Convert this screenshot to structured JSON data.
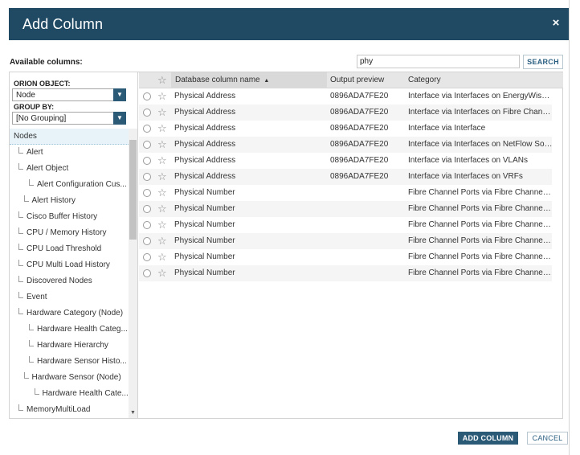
{
  "dialog": {
    "title": "Add Column",
    "close_glyph": "×"
  },
  "toolbar": {
    "available_label": "Available columns:",
    "search_value": "phy",
    "search_button": "SEARCH"
  },
  "left_panel": {
    "orion_object_label": "ORION OBJECT:",
    "orion_object_value": "Node",
    "group_by_label": "GROUP BY:",
    "group_by_value": "[No Grouping]",
    "tree": [
      {
        "label": "Nodes",
        "level": 0,
        "selected": true
      },
      {
        "label": "Alert",
        "level": 1
      },
      {
        "label": "Alert Object",
        "level": 1
      },
      {
        "label": "Alert Configuration Cus...",
        "level": 2
      },
      {
        "label": "Alert History",
        "level": 1.5
      },
      {
        "label": "Cisco Buffer History",
        "level": 1
      },
      {
        "label": "CPU / Memory History",
        "level": 1
      },
      {
        "label": "CPU Load Threshold",
        "level": 1
      },
      {
        "label": "CPU Multi Load History",
        "level": 1
      },
      {
        "label": "Discovered Nodes",
        "level": 1
      },
      {
        "label": "Event",
        "level": 1
      },
      {
        "label": "Hardware Category (Node)",
        "level": 1
      },
      {
        "label": "Hardware Health Categ...",
        "level": 2
      },
      {
        "label": "Hardware Hierarchy",
        "level": 2
      },
      {
        "label": "Hardware Sensor Histo...",
        "level": 2
      },
      {
        "label": "Hardware Sensor (Node)",
        "level": 1.5
      },
      {
        "label": "Hardware Health Cate...",
        "level": 2.5
      },
      {
        "label": "MemoryMultiLoad",
        "level": 1
      }
    ]
  },
  "grid": {
    "columns": [
      "Database column name",
      "Output preview",
      "Category"
    ],
    "sort_indicator": "▲",
    "rows": [
      {
        "name": "Physical Address",
        "preview": "0896ADA7FE20",
        "category": "Interface via Interfaces on EnergyWise ..."
      },
      {
        "name": "Physical Address",
        "preview": "0896ADA7FE20",
        "category": "Interface via Interfaces on Fibre Chann..."
      },
      {
        "name": "Physical Address",
        "preview": "0896ADA7FE20",
        "category": "Interface via Interface"
      },
      {
        "name": "Physical Address",
        "preview": "0896ADA7FE20",
        "category": "Interface via Interfaces on NetFlow Sou..."
      },
      {
        "name": "Physical Address",
        "preview": "0896ADA7FE20",
        "category": "Interface via Interfaces on VLANs"
      },
      {
        "name": "Physical Address",
        "preview": "0896ADA7FE20",
        "category": "Interface via Interfaces on VRFs"
      },
      {
        "name": "Physical Number",
        "preview": "",
        "category": "Fibre Channel Ports via Fibre Channel P..."
      },
      {
        "name": "Physical Number",
        "preview": "",
        "category": "Fibre Channel Ports via Fibre Channel P..."
      },
      {
        "name": "Physical Number",
        "preview": "",
        "category": "Fibre Channel Ports via Fibre Channel P..."
      },
      {
        "name": "Physical Number",
        "preview": "",
        "category": "Fibre Channel Ports via Fibre Channel P..."
      },
      {
        "name": "Physical Number",
        "preview": "",
        "category": "Fibre Channel Ports via Fibre Channel P..."
      },
      {
        "name": "Physical Number",
        "preview": "",
        "category": "Fibre Channel Ports via Fibre Channel P..."
      }
    ]
  },
  "footer": {
    "add_button": "ADD COLUMN",
    "cancel_button": "CANCEL"
  },
  "colors": {
    "header_bg": "#204a63",
    "accent": "#2b5a77"
  },
  "icons": [
    "close-icon",
    "chevron-down-icon",
    "star-icon",
    "radio-icon",
    "sort-ascending-icon"
  ]
}
